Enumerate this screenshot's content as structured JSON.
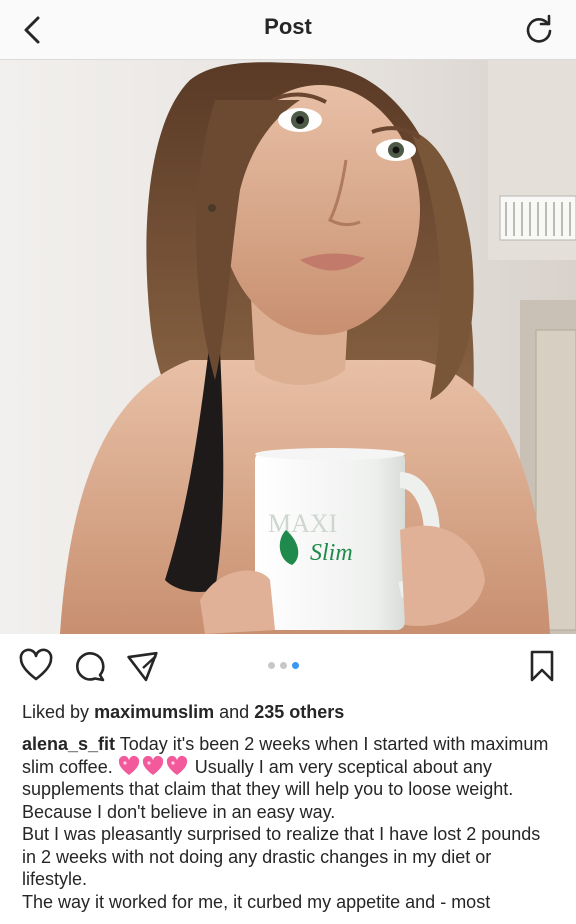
{
  "header": {
    "title": "Post",
    "back_icon": "chevron-left-icon",
    "refresh_icon": "refresh-icon"
  },
  "photo": {
    "mug_brand": "MAXI",
    "mug_script": "Slim"
  },
  "actions": {
    "icons": [
      "heart-icon",
      "comment-icon",
      "share-icon",
      "bookmark-icon"
    ],
    "carousel_dots": 3,
    "carousel_active_index": 2,
    "accent_color": "#3897f0"
  },
  "likes": {
    "prefix": "Liked by",
    "user": "maximumslim",
    "connector": "and",
    "count_text": "235 others"
  },
  "caption": {
    "username": "alena_s_fit",
    "text_part1": "Today it's been 2 weeks when I started with maximum slim coffee.",
    "emoji": "sparkling-heart-emoji",
    "emoji_count": 3,
    "text_part2": "Usually I am very sceptical about any supplements that claim that they will help you to loose weight. Because I don't believe in an easy way.",
    "paragraph2": "But I was pleasantly surprised to realize that I have lost 2 pounds in 2 weeks with not doing any drastic changes in my diet or lifestyle.",
    "paragraph3": "The way it worked for me, it curbed my appetite and - most"
  }
}
